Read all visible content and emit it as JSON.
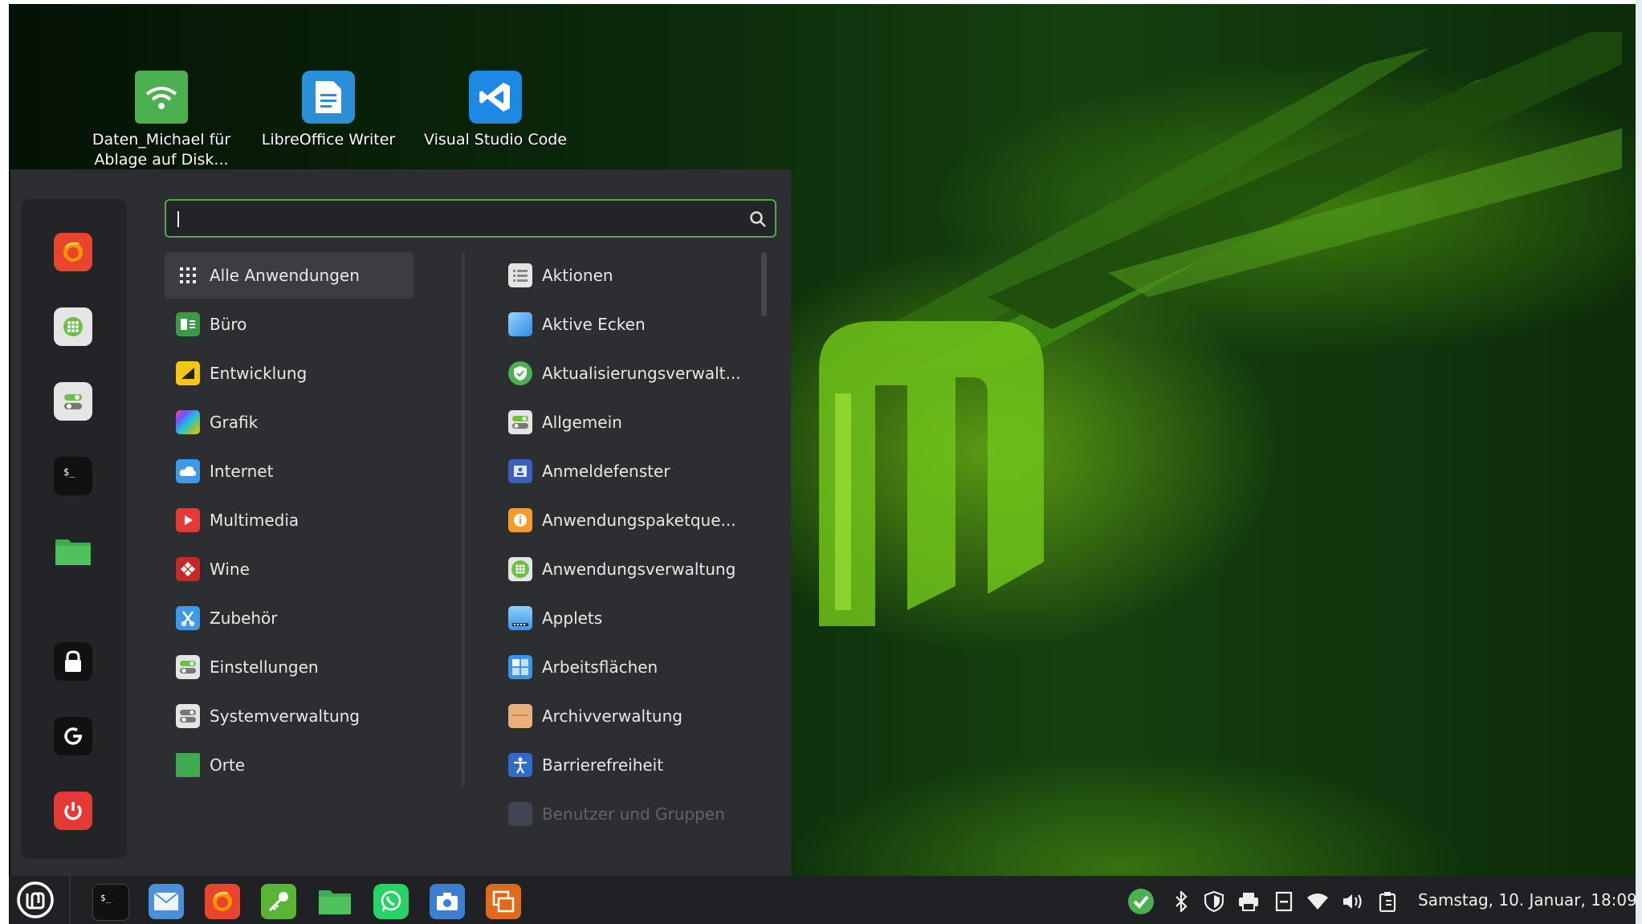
{
  "desktop": {
    "icons": [
      {
        "label": "Daten_Michael für Ablage auf Disk...",
        "color": "#4caf50"
      },
      {
        "label": "LibreOffice Writer",
        "color": "#2a8fd6"
      },
      {
        "label": "Visual Studio Code",
        "color": "#1e88e5"
      }
    ]
  },
  "menu": {
    "search": {
      "value": ""
    },
    "favorites": [
      {
        "name": "firefox-icon",
        "color": "#e8452c"
      },
      {
        "name": "software-manager-icon",
        "color": "#e5e5e5"
      },
      {
        "name": "settings-toggle-icon",
        "color": "#e5e5e5"
      },
      {
        "name": "terminal-icon",
        "color": "#111111"
      },
      {
        "name": "folder-icon",
        "color": "#3faa50"
      },
      {
        "name": "lock-icon",
        "color": "#111111"
      },
      {
        "name": "logout-icon",
        "color": "#111111"
      },
      {
        "name": "power-icon",
        "color": "#e53935"
      }
    ],
    "categories": [
      {
        "label": "Alle Anwendungen",
        "icon": "grid-icon",
        "selected": true
      },
      {
        "label": "Büro",
        "icon": "office-icon"
      },
      {
        "label": "Entwicklung",
        "icon": "development-icon"
      },
      {
        "label": "Grafik",
        "icon": "graphics-icon"
      },
      {
        "label": "Internet",
        "icon": "internet-icon"
      },
      {
        "label": "Multimedia",
        "icon": "multimedia-icon"
      },
      {
        "label": "Wine",
        "icon": "wine-icon"
      },
      {
        "label": "Zubehör",
        "icon": "accessories-icon"
      },
      {
        "label": "Einstellungen",
        "icon": "preferences-icon"
      },
      {
        "label": "Systemverwaltung",
        "icon": "administration-icon"
      },
      {
        "label": "Orte",
        "icon": "places-icon"
      }
    ],
    "apps": [
      {
        "label": "Aktionen",
        "icon": "actions-icon"
      },
      {
        "label": "Aktive Ecken",
        "icon": "hot-corners-icon"
      },
      {
        "label": "Aktualisierungsverwalt...",
        "icon": "update-manager-icon"
      },
      {
        "label": "Allgemein",
        "icon": "general-icon"
      },
      {
        "label": "Anmeldefenster",
        "icon": "login-window-icon"
      },
      {
        "label": "Anwendungspaketque...",
        "icon": "package-sources-icon"
      },
      {
        "label": "Anwendungsverwaltung",
        "icon": "software-manager-icon"
      },
      {
        "label": "Applets",
        "icon": "applets-icon"
      },
      {
        "label": "Arbeitsflächen",
        "icon": "workspaces-icon"
      },
      {
        "label": "Archivverwaltung",
        "icon": "archive-manager-icon"
      },
      {
        "label": "Barrierefreiheit",
        "icon": "accessibility-icon"
      },
      {
        "label": "Benutzer und Gruppen",
        "icon": "users-groups-icon"
      }
    ]
  },
  "taskbar": {
    "apps": [
      "menu-icon",
      "terminal-icon",
      "mail-icon",
      "firefox-icon",
      "keys-icon",
      "files-icon",
      "whatsapp-icon",
      "screenshot-icon",
      "workspace-switcher-icon"
    ],
    "tray": [
      "update-ok-icon",
      "bluetooth-icon",
      "shield-icon",
      "printer-icon",
      "notes-icon",
      "wifi-icon",
      "volume-icon",
      "clipboard-icon"
    ],
    "clock": "Samstag, 10. Januar, 18:09"
  }
}
